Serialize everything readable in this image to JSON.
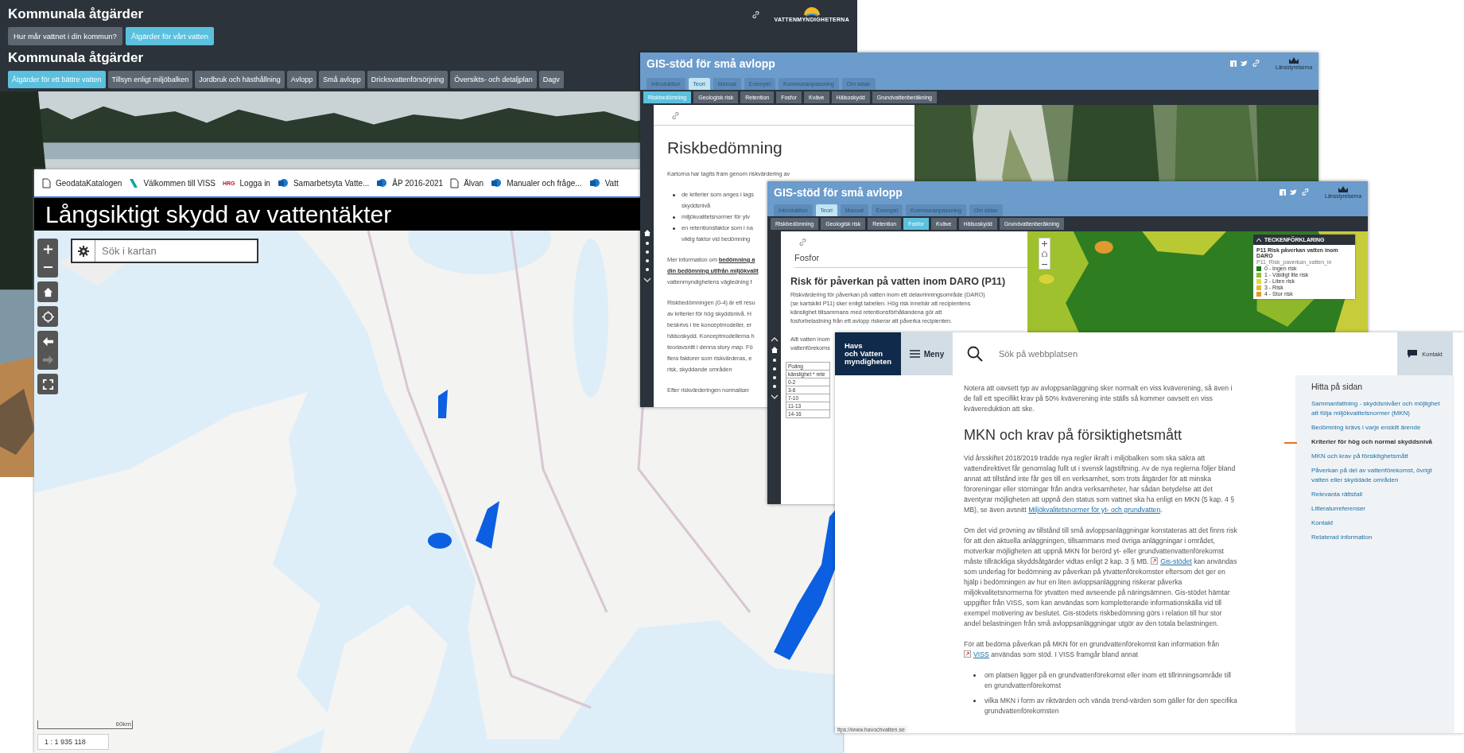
{
  "kommunala": {
    "title": "Kommunala åtgärder",
    "logo_text": "VATTENMYNDIGHETERNA",
    "nav_buttons": [
      {
        "label": "Hur mår vattnet i din kommun?",
        "selected": false
      },
      {
        "label": "Åtgärder för vårt vatten",
        "selected": true
      }
    ],
    "subtitle": "Kommunala åtgärder",
    "tabs": [
      {
        "label": "Åtgärder för ett bättre vatten",
        "selected": true
      },
      {
        "label": "Tillsyn enligt miljöbalken",
        "selected": false
      },
      {
        "label": "Jordbruk och hästhållning",
        "selected": false
      },
      {
        "label": "Avlopp",
        "selected": false
      },
      {
        "label": "Små avlopp",
        "selected": false
      },
      {
        "label": "Dricksvattenförsörjning",
        "selected": false
      },
      {
        "label": "Översikts- och detaljplan",
        "selected": false
      },
      {
        "label": "Dagv",
        "selected": false
      }
    ],
    "photo": {
      "kind": "picture"
    }
  },
  "map_window": {
    "bookmarks": [
      {
        "label": "GeodataKatalogen",
        "kind": "page"
      },
      {
        "label": "Välkommen till VISS",
        "kind": "stripe"
      },
      {
        "label": "Logga in",
        "kind": "badge",
        "badge": "HRG"
      },
      {
        "label": "Samarbetsyta Vatte...",
        "kind": "site"
      },
      {
        "label": "ÅP 2016-2021",
        "kind": "site"
      },
      {
        "label": "Älvan",
        "kind": "page"
      },
      {
        "label": "Manualer och fråge...",
        "kind": "site"
      },
      {
        "label": "Vatt",
        "kind": "site"
      }
    ],
    "title": "Långsiktigt skydd av vattentäkter",
    "search": {
      "placeholder": "Sök i kartan"
    },
    "control_groups": [
      {
        "controls": [
          {
            "kind": "zoom_in",
            "disabled": false
          },
          {
            "kind": "zoom_out",
            "disabled": false
          }
        ]
      },
      {
        "controls": [
          {
            "kind": "home",
            "disabled": false
          }
        ]
      },
      {
        "controls": [
          {
            "kind": "locate",
            "disabled": false
          }
        ]
      },
      {
        "controls": [
          {
            "kind": "back",
            "disabled": false
          },
          {
            "kind": "forward",
            "disabled": true
          }
        ]
      },
      {
        "controls": [
          {
            "kind": "fullscreen",
            "disabled": false
          }
        ]
      }
    ],
    "map": {
      "kind": "picture"
    },
    "scale_bar": "60km",
    "scale": "1 : 1 935 118"
  },
  "gis_windows": [
    {
      "title": "GIS-stöd för små avlopp",
      "logo_text": "Länsstyrelserna",
      "nav_up": false,
      "tabs": [
        {
          "label": "Introduktion",
          "selected": false
        },
        {
          "label": "Teori",
          "selected": true
        },
        {
          "label": "Manual",
          "selected": false
        },
        {
          "label": "Exempel",
          "selected": false
        },
        {
          "label": "Kommunanpassning",
          "selected": false
        },
        {
          "label": "Om sidan",
          "selected": false
        }
      ],
      "subtabs": [
        {
          "label": "Riskbedömning",
          "selected": true
        },
        {
          "label": "Geologisk risk",
          "selected": false
        },
        {
          "label": "Retention",
          "selected": false
        },
        {
          "label": "Fosfor",
          "selected": false
        },
        {
          "label": "Kväve",
          "selected": false
        },
        {
          "label": "Hälsoskydd",
          "selected": false
        },
        {
          "label": "Grundvattenberäkning",
          "selected": false
        }
      ],
      "blocks": [
        {
          "kind": "title",
          "text": "Riskbedömning"
        },
        {
          "kind": "p",
          "lines": [
            [
              {
                "text": "Kartorna har tagits fram genom riskvärdering av"
              }
            ]
          ]
        },
        {
          "kind": "bullets",
          "items": [
            "de kriterier som anges i lags\nskyddsnivå",
            "miljökvalitetsnormer för ytv",
            "en retentionsfaktor som i na\nviktig faktor vid bedömning"
          ]
        },
        {
          "kind": "p",
          "lines": [
            [
              {
                "text": "Mer information om "
              },
              {
                "link": "bedömning a"
              }
            ],
            [
              {
                "link": "din bedömning utifrån miljökvalit"
              }
            ],
            [
              {
                "text": "vattenmyndighetens vägledning f"
              }
            ]
          ]
        },
        {
          "kind": "p",
          "lines": [
            [
              {
                "text": "Riskbedömningen (0-4) är ett resu"
              }
            ],
            [
              {
                "text": "av kriterier för hög skyddsnivå. H"
              }
            ],
            [
              {
                "text": "beskrivs i tre konceptmodeller, er"
              }
            ],
            [
              {
                "text": "hälsoskydd. Konceptmodellerna h"
              }
            ],
            [
              {
                "text": "teoriavsnitt i denna story map. Fö"
              }
            ],
            [
              {
                "text": "flera faktorer som riskvärderas, e"
              }
            ],
            [
              {
                "text": "risk, skyddande områden"
              }
            ]
          ]
        },
        {
          "kind": "p",
          "lines": [
            [
              {
                "text": "Efter riskvärderingen normaliser"
              }
            ]
          ]
        }
      ],
      "media": {
        "kind": "picture"
      }
    },
    {
      "title": "GIS-stöd för små avlopp",
      "logo_text": "Länsstyrelserna",
      "nav_up": true,
      "tabs": [
        {
          "label": "Introduktion",
          "selected": false
        },
        {
          "label": "Teori",
          "selected": true
        },
        {
          "label": "Manual",
          "selected": false
        },
        {
          "label": "Exempel",
          "selected": false
        },
        {
          "label": "Kommunanpassning",
          "selected": false
        },
        {
          "label": "Om sidan",
          "selected": false
        }
      ],
      "subtabs": [
        {
          "label": "Riskbedömning",
          "selected": false
        },
        {
          "label": "Geologisk risk",
          "selected": false
        },
        {
          "label": "Retention",
          "selected": false
        },
        {
          "label": "Fosfor",
          "selected": true
        },
        {
          "label": "Kväve",
          "selected": false
        },
        {
          "label": "Hälsoskydd",
          "selected": false
        },
        {
          "label": "Grundvattenberäkning",
          "selected": false
        }
      ],
      "blocks": [
        {
          "kind": "heading",
          "text": "Fosfor"
        },
        {
          "kind": "subheading",
          "text": "Risk för påverkan på vatten inom DARO (P11)"
        },
        {
          "kind": "p",
          "lines": [
            [
              {
                "text": "Riskvärdering för påverkan på vatten inom ett delavrinningsområde (DARO)"
              }
            ],
            [
              {
                "text": "(se kartskikt P11) sker enligt tabellen. Hög risk innebär att recipientens"
              }
            ],
            [
              {
                "text": "känslighet tillsammans med retentionsförhållandena gör att"
              }
            ],
            [
              {
                "text": "fosforbelastning från ett avlopp riskerar att påverka recipienten."
              }
            ]
          ]
        },
        {
          "kind": "p",
          "lines": [
            [
              {
                "text": "Allt vatten inom"
              }
            ],
            [
              {
                "text": "vattenförekoms"
              }
            ]
          ]
        },
        {
          "kind": "table",
          "rows": [
            "Poäng",
            "känslighet * rete",
            "0-2",
            "3-6",
            "7-10",
            "11-13",
            "14-16"
          ]
        }
      ],
      "media": {
        "kind": "map",
        "legend": {
          "title": "TECKENFÖRKLARING",
          "layer": "P11 Risk påverkan vatten inom DARO",
          "sublayer": "P11_Risk_paverkan_vatten_in",
          "items": [
            {
              "label": "0 - Ingen risk",
              "color": "#1e7a1e"
            },
            {
              "label": "1 - Väldigt lite risk",
              "color": "#8cbf2c"
            },
            {
              "label": "2 - Liten risk",
              "color": "#e0dc3a"
            },
            {
              "label": "3 - Risk",
              "color": "#e8b52e"
            },
            {
              "label": "4 - Stor risk",
              "color": "#e8962a"
            }
          ]
        }
      }
    }
  ],
  "havs": {
    "logo": "Havs\noch Vatten\nmyndigheten",
    "menu": "Meny",
    "search": {
      "placeholder": "Sök på webbplatsen"
    },
    "contact": "Kontakt",
    "blocks": [
      {
        "kind": "p",
        "parts": [
          {
            "text": "Notera att oavsett typ av avloppsanläggning sker normalt en viss kväverening, så även i de fall ett specifikt krav på 50% kväverening inte ställs så kommer oavsett en viss kvävereduktion att ske."
          }
        ]
      },
      {
        "kind": "h2",
        "text": "MKN och krav på försiktighetsmått"
      },
      {
        "kind": "p",
        "parts": [
          {
            "text": "Vid årsskiftet 2018/2019 trädde nya regler ikraft i miljöbalken som ska säkra att vattendirektivet får genomslag fullt ut i svensk lagstiftning. Av de nya reglerna följer bland annat att tillstånd inte får ges till en verksamhet, som trots åtgärder för att minska föroreningar eller störningar från andra verksamheter, har sådan betydelse att det äventyrar möjligheten att uppnå den status som vattnet ska ha enligt en MKN (5 kap. 4 § MB), se även avsnitt "
          },
          {
            "link": "Miljökvalitetsnormer för yt- och grundvatten"
          },
          {
            "text": "."
          }
        ]
      },
      {
        "kind": "p",
        "parts": [
          {
            "text": "Om det vid prövning av tillstånd till små avloppsanläggningar konstateras att det finns risk för att den aktuella anläggningen, tillsammans med övriga anläggningar i området, motverkar möjligheten att uppnå MKN för berörd yt- eller grundvattenvattenförekomst måste tillräckliga skyddsåtgärder vidtas enligt 2 kap. 3 § MB. "
          },
          {
            "link": "Gis-stödet",
            "external": true
          },
          {
            "text": " kan användas som underlag för bedömning av påverkan på ytvattenförekomster eftersom det ger en hjälp i bedömningen av hur en liten avloppsanläggning riskerar påverka miljökvalitetsnormerna för ytvatten med avseende på näringsämnen. Gis-stödet hämtar uppgifter från VISS, som kan användas som kompletterande informationskälla vid till exempel motivering av beslutet. Gis-stödets riskbedömning görs i relation till hur stor andel belastningen från små avloppsanläggningar utgör av den totala belastningen."
          }
        ]
      },
      {
        "kind": "p",
        "parts": [
          {
            "text": "För att bedöma påverkan på MKN för en grundvattenförekomst kan information från "
          },
          {
            "link": "VISS",
            "external": true
          },
          {
            "text": " användas som stöd. I VISS framgår bland annat"
          }
        ]
      },
      {
        "kind": "bullets",
        "items": [
          "om platsen ligger på en grundvattenförekomst eller inom ett tillrinningsområde till en grundvattenförekomst",
          "vilka MKN i form av riktvärden och vända trend-värden som gäller för den specifika grundvattenförekomsten"
        ]
      }
    ],
    "toc": {
      "title": "Hitta på sidan",
      "items": [
        {
          "label": "Sammanfattning - skyddsnivåer och möjlighet att följa miljökvalitetsnormer (MKN)",
          "selected": false
        },
        {
          "label": "Bedömning krävs i varje enskilt ärende",
          "selected": false
        },
        {
          "label": "Kriterier för hög och normal skyddsnivå",
          "selected": true
        },
        {
          "label": "MKN och krav på försiktighetsmått",
          "selected": false
        },
        {
          "label": "Påverkan på del av vattenförekomst, övrigt vatten eller skyddade områden",
          "selected": false
        },
        {
          "label": "Relevanta rättsfall",
          "selected": false
        },
        {
          "label": "Litteraturreferenser",
          "selected": false
        },
        {
          "label": "Kontakt",
          "selected": false
        },
        {
          "label": "Relaterad information",
          "selected": false
        }
      ]
    },
    "status_url": "ttps://www.havochvatten.se"
  }
}
